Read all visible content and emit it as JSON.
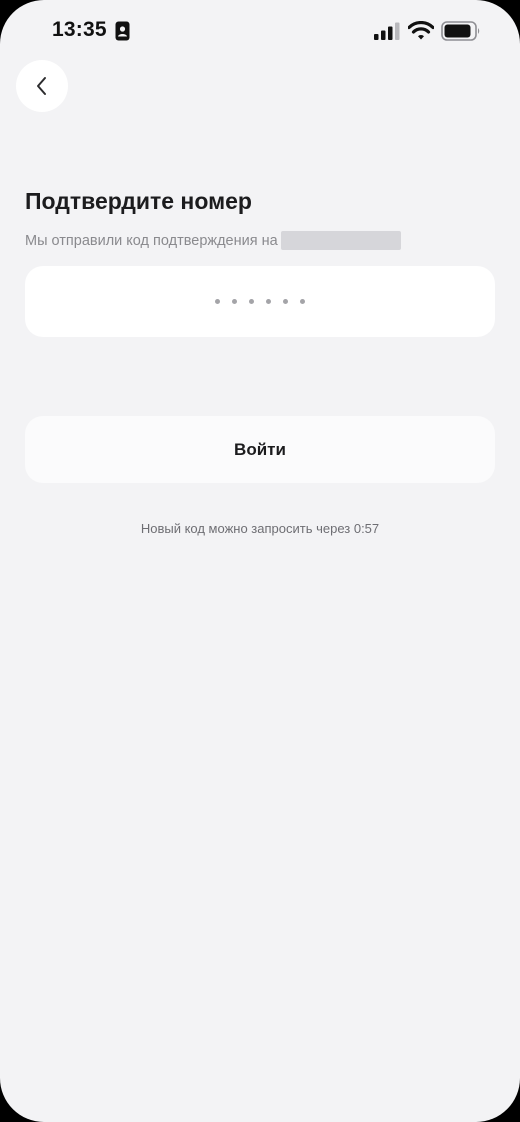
{
  "status_bar": {
    "time": "13:35",
    "icons": [
      "id-badge-icon",
      "cellular-signal-icon",
      "wifi-icon",
      "battery-icon"
    ]
  },
  "navigation": {
    "back_icon": "chevron-left-icon"
  },
  "header": {
    "title": "Подтвердите номер",
    "subtitle": "Мы отправили код подтверждения на"
  },
  "code_input": {
    "placeholder": "••••••",
    "digits": 6
  },
  "actions": {
    "login_label": "Войти"
  },
  "resend": {
    "text": "Новый код можно запросить через 0:57"
  },
  "colors": {
    "background": "#f3f3f5",
    "surface": "#ffffff",
    "primary_text": "#1c1c1e",
    "secondary_text": "#8a8a8e",
    "redaction": "#d6d6da"
  }
}
